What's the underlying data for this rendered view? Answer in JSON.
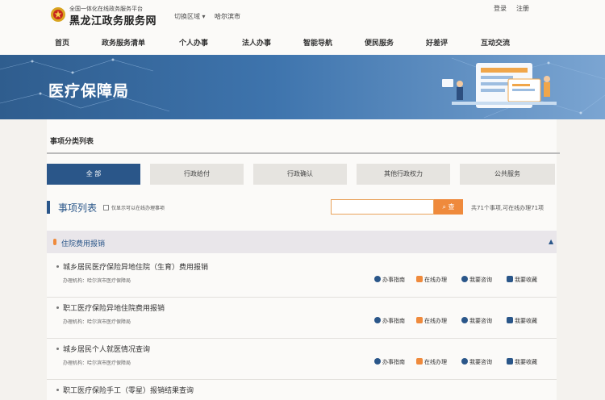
{
  "header": {
    "brand_small": "全国一体化在线政务服务平台",
    "brand_big": "黑龙江政务服务网",
    "region_switch": "切换区域 ▾",
    "city": "哈尔滨市",
    "login": "登录",
    "register": "注册"
  },
  "nav": [
    "首页",
    "政务服务清单",
    "个人办事",
    "法人办事",
    "智能导航",
    "便民服务",
    "好差评",
    "互动交流"
  ],
  "banner": {
    "title": "医疗保障局"
  },
  "section": {
    "title": "事项分类列表"
  },
  "tabs": [
    "全 部",
    "行政给付",
    "行政确认",
    "其他行政权力",
    "公共服务"
  ],
  "list": {
    "title": "事项列表",
    "checkbox_label": "仅显示可以在线办理事项",
    "search_placeholder": "",
    "search_button": "⌕ 查",
    "count": "共71个事项,可在线办理71项"
  },
  "group": {
    "title": "住院费用报销",
    "caret": "▲"
  },
  "items": [
    {
      "title": "城乡居民医疗保险异地住院（生育）费用报销",
      "org": "办理机构：哈尔滨市医疗保障局"
    },
    {
      "title": "职工医疗保险异地住院费用报销",
      "org": "办理机构：哈尔滨市医疗保障局"
    },
    {
      "title": "城乡居民个人就医情况查询",
      "org": "办理机构：哈尔滨市医疗保障局"
    },
    {
      "title": "职工医疗保险手工（零星）报销结果查询",
      "org": ""
    }
  ],
  "actions": [
    "办事指南",
    "在线办理",
    "我要咨询",
    "我要收藏"
  ],
  "colors": {
    "primary": "#2a5689",
    "accent": "#ef8a3c"
  }
}
